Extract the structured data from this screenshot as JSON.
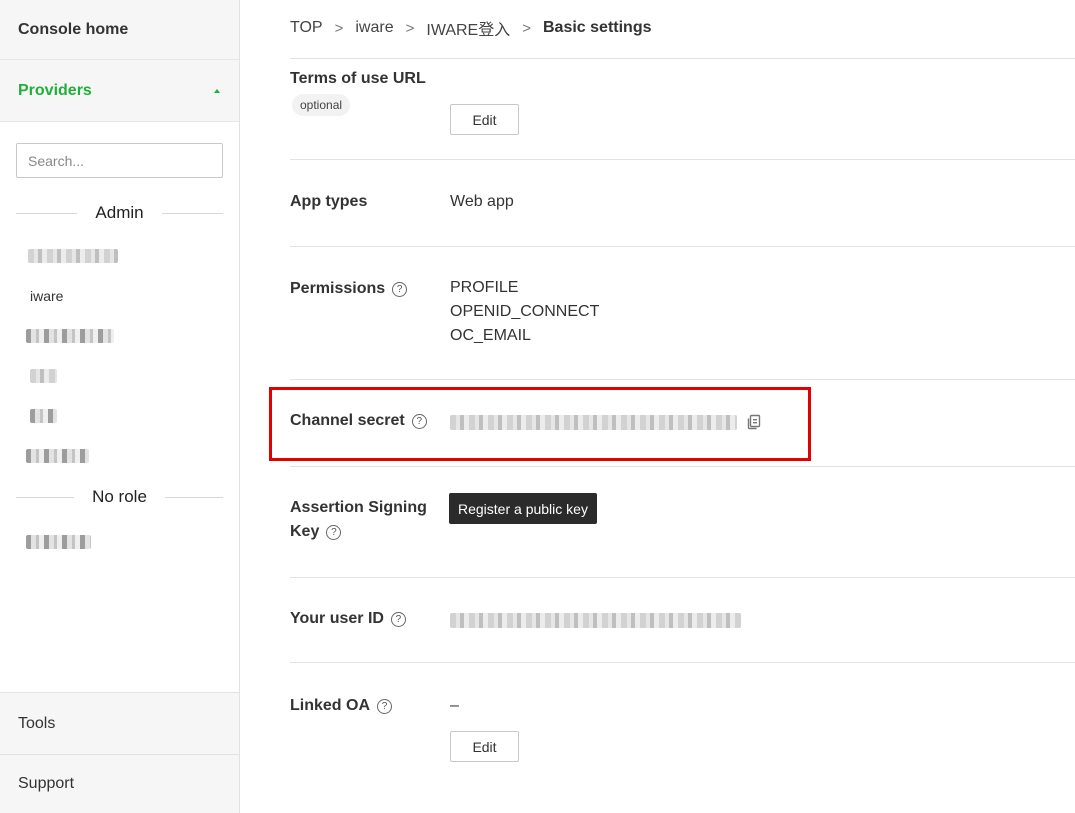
{
  "sidebar": {
    "console_home": "Console home",
    "providers": "Providers",
    "search_placeholder": "Search...",
    "section_admin": "Admin",
    "section_no_role": "No role",
    "admin_items": [
      "",
      "iware",
      "",
      "",
      "",
      ""
    ],
    "no_role_items": [
      ""
    ],
    "tools": "Tools",
    "support": "Support"
  },
  "breadcrumb": {
    "items": [
      "TOP",
      "iware",
      "IWARE登入",
      "Basic settings"
    ],
    "separator": ">"
  },
  "fields": {
    "terms": {
      "label": "Terms of use URL",
      "badge": "optional",
      "button": "Edit"
    },
    "app_types": {
      "label": "App types",
      "value": "Web app"
    },
    "permissions": {
      "label": "Permissions",
      "values": [
        "PROFILE",
        "OPENID_CONNECT",
        "OC_EMAIL"
      ]
    },
    "channel_secret": {
      "label": "Channel secret"
    },
    "assertion": {
      "label_line1": "Assertion Signing",
      "label_line2": "Key",
      "button": "Register a public key"
    },
    "user_id": {
      "label": "Your user ID"
    },
    "linked_oa": {
      "label": "Linked OA",
      "value": "–",
      "button": "Edit"
    }
  },
  "icons": {
    "help": "question-circle-icon",
    "copy": "copy-icon",
    "caret": "caret-up-icon"
  },
  "colors": {
    "accent_green": "#20b03a",
    "highlight_red": "#e30000",
    "dark_button": "#2b2b2b"
  }
}
